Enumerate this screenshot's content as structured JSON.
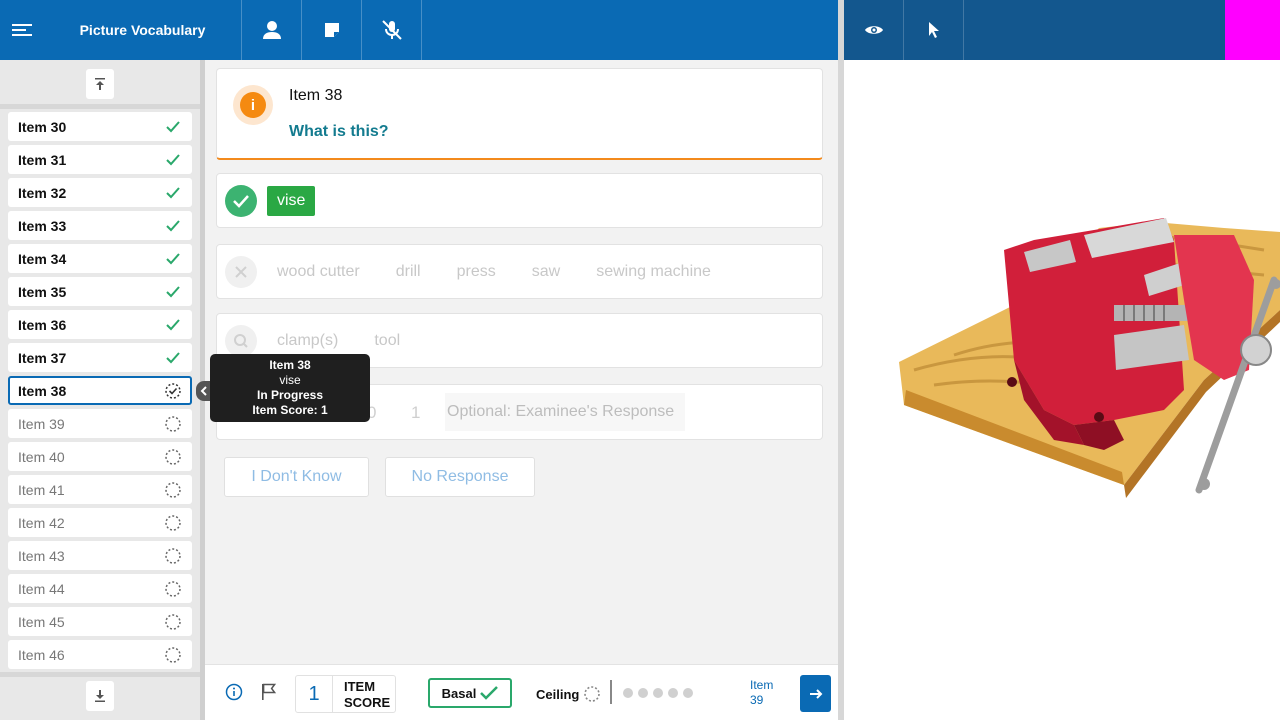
{
  "app": {
    "title": "Picture Vocabulary",
    "menu_icon": "menu-icon",
    "toolbar_icons": [
      "person-icon",
      "note-icon",
      "mic-off-icon"
    ],
    "right_toolbar_icons": [
      "eye-icon",
      "pointer-icon"
    ],
    "accent_color": "#0a6ab4",
    "right_bar_color": "#13578e"
  },
  "sidebar": {
    "items": [
      {
        "label": "Item 30",
        "status": "done"
      },
      {
        "label": "Item 31",
        "status": "done"
      },
      {
        "label": "Item 32",
        "status": "done"
      },
      {
        "label": "Item 33",
        "status": "done"
      },
      {
        "label": "Item 34",
        "status": "done"
      },
      {
        "label": "Item 35",
        "status": "done"
      },
      {
        "label": "Item 36",
        "status": "done"
      },
      {
        "label": "Item 37",
        "status": "done"
      },
      {
        "label": "Item 38",
        "status": "current"
      },
      {
        "label": "Item 39",
        "status": "pending"
      },
      {
        "label": "Item 40",
        "status": "pending"
      },
      {
        "label": "Item 41",
        "status": "pending"
      },
      {
        "label": "Item 42",
        "status": "pending"
      },
      {
        "label": "Item 43",
        "status": "pending"
      },
      {
        "label": "Item 44",
        "status": "pending"
      },
      {
        "label": "Item 45",
        "status": "pending"
      },
      {
        "label": "Item 46",
        "status": "pending"
      }
    ]
  },
  "tooltip": {
    "item": "Item 38",
    "response": "vise",
    "state": "In Progress",
    "score": "Item Score: 1"
  },
  "question": {
    "item_label": "Item 38",
    "prompt": "What is this?"
  },
  "responses": {
    "correct": [
      "vise"
    ],
    "incorrect": [
      "wood cutter",
      "drill",
      "press",
      "saw",
      "sewing machine"
    ],
    "query": [
      "clamp(s)",
      "tool"
    ]
  },
  "scoring": {
    "options": [
      "0",
      "1"
    ],
    "examinee_placeholder": "Optional: Examinee's Response"
  },
  "actions": {
    "dont_know": "I Don't Know",
    "no_response": "No Response"
  },
  "bottom": {
    "item_score_value": "1",
    "item_score_label_1": "ITEM",
    "item_score_label_2": "SCORE",
    "basal_label": "Basal",
    "ceiling_label": "Ceiling",
    "next_item_label_1": "Item",
    "next_item_label_2": "39",
    "dot_count": 5
  },
  "picture": {
    "subject": "vise"
  }
}
